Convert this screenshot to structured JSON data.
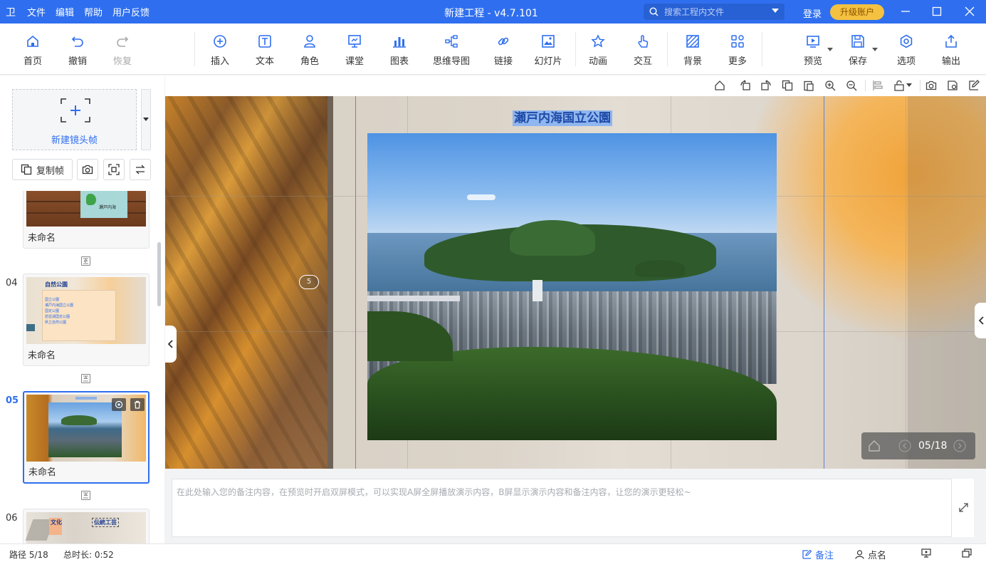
{
  "titlebar": {
    "logo": "卫",
    "menu": [
      "文件",
      "编辑",
      "帮助",
      "用户反馈"
    ],
    "title": "新建工程 - v4.7.101",
    "search_placeholder": "搜索工程内文件",
    "login": "登录",
    "upgrade": "升级账户"
  },
  "toolbar": {
    "home": "首页",
    "undo": "撤销",
    "redo": "恢复",
    "insert": "插入",
    "text": "文本",
    "role": "角色",
    "classroom": "课堂",
    "chart": "图表",
    "mindmap": "思维导图",
    "link": "链接",
    "slide": "幻灯片",
    "animation": "动画",
    "interact": "交互",
    "background": "背景",
    "more": "更多",
    "preview": "预览",
    "save": "保存",
    "options": "选项",
    "export": "输出"
  },
  "leftpanel": {
    "new_frame": "新建镜头帧",
    "copy_frame": "复制帧",
    "frames": [
      {
        "num": "",
        "name": "未命名",
        "map_label": "瀬戸内海"
      },
      {
        "num": "04",
        "name": "未命名",
        "title": "自然公園",
        "lines": [
          "国立公園",
          "瀬戸内海国立公園",
          "国定公園",
          "琵琶湖国定公園",
          "県立自然公園"
        ]
      },
      {
        "num": "05",
        "name": "未命名"
      },
      {
        "num": "06",
        "name": "",
        "tag1": "文化",
        "tag2": "伝統工芸"
      }
    ]
  },
  "canvas": {
    "slide_title": "瀬戸内海国立公園",
    "path_marker": "5",
    "nav_counter": "05/18"
  },
  "notes": {
    "placeholder": "在此处输入您的备注内容，在预览时开启双屏模式，可以实现A屏全屏播放演示内容，B屏显示演示内容和备注内容，让您的演示更轻松~"
  },
  "status": {
    "path": "路径 5/18",
    "duration": "总时长: 0:52",
    "notes": "备注",
    "rollcall": "点名"
  },
  "colors": {
    "accent": "#2f6fef",
    "upgrade": "#f5c140"
  }
}
